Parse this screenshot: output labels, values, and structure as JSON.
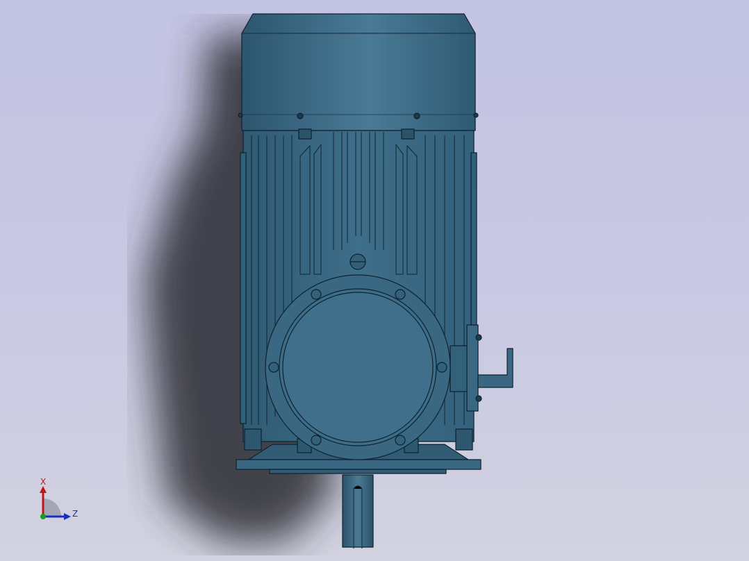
{
  "view": {
    "background_top": "#c3c3e3",
    "background_bottom": "#d2d2e0",
    "part_color": "#3d6a85",
    "edge_color": "#0e2230"
  },
  "triad": {
    "x_label": "X",
    "z_label": "Z",
    "x_color": "#c0141c",
    "z_color": "#1a2fb8",
    "y_color": "#16a016"
  }
}
